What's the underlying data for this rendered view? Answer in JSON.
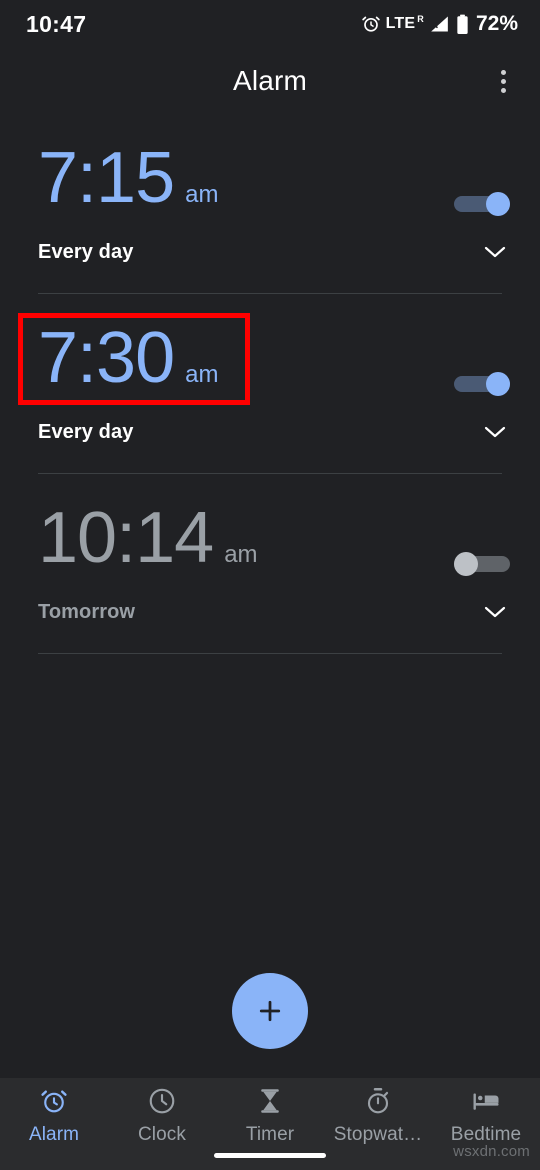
{
  "status_bar": {
    "time": "10:47",
    "network": "LTE",
    "roaming_superscript": "R",
    "battery_percent": "72%",
    "icons": [
      "alarm-clock-icon",
      "signal-icon",
      "battery-icon"
    ]
  },
  "app_bar": {
    "title": "Alarm",
    "overflow_menu": "more-options"
  },
  "alarms": [
    {
      "time": "7:15",
      "meridiem": "am",
      "days": "Every day",
      "enabled": true,
      "highlighted": false
    },
    {
      "time": "7:30",
      "meridiem": "am",
      "days": "Every day",
      "enabled": true,
      "highlighted": true
    },
    {
      "time": "10:14",
      "meridiem": "am",
      "days": "Tomorrow",
      "enabled": false,
      "highlighted": false
    }
  ],
  "fab": {
    "label": "+",
    "name": "add-alarm"
  },
  "bottom_nav": {
    "items": [
      {
        "label": "Alarm",
        "icon": "alarm-clock-icon",
        "active": true
      },
      {
        "label": "Clock",
        "icon": "clock-icon",
        "active": false
      },
      {
        "label": "Timer",
        "icon": "hourglass-icon",
        "active": false
      },
      {
        "label": "Stopwat…",
        "icon": "stopwatch-icon",
        "active": false
      },
      {
        "label": "Bedtime",
        "icon": "bed-icon",
        "active": false
      }
    ]
  },
  "watermark": "wsxdn.com",
  "colors": {
    "background": "#202124",
    "nav_background": "#2b2c2e",
    "accent": "#8ab4f8",
    "inactive": "#9aa0a6",
    "divider": "#3c4043",
    "annotation": "#ff0000"
  }
}
